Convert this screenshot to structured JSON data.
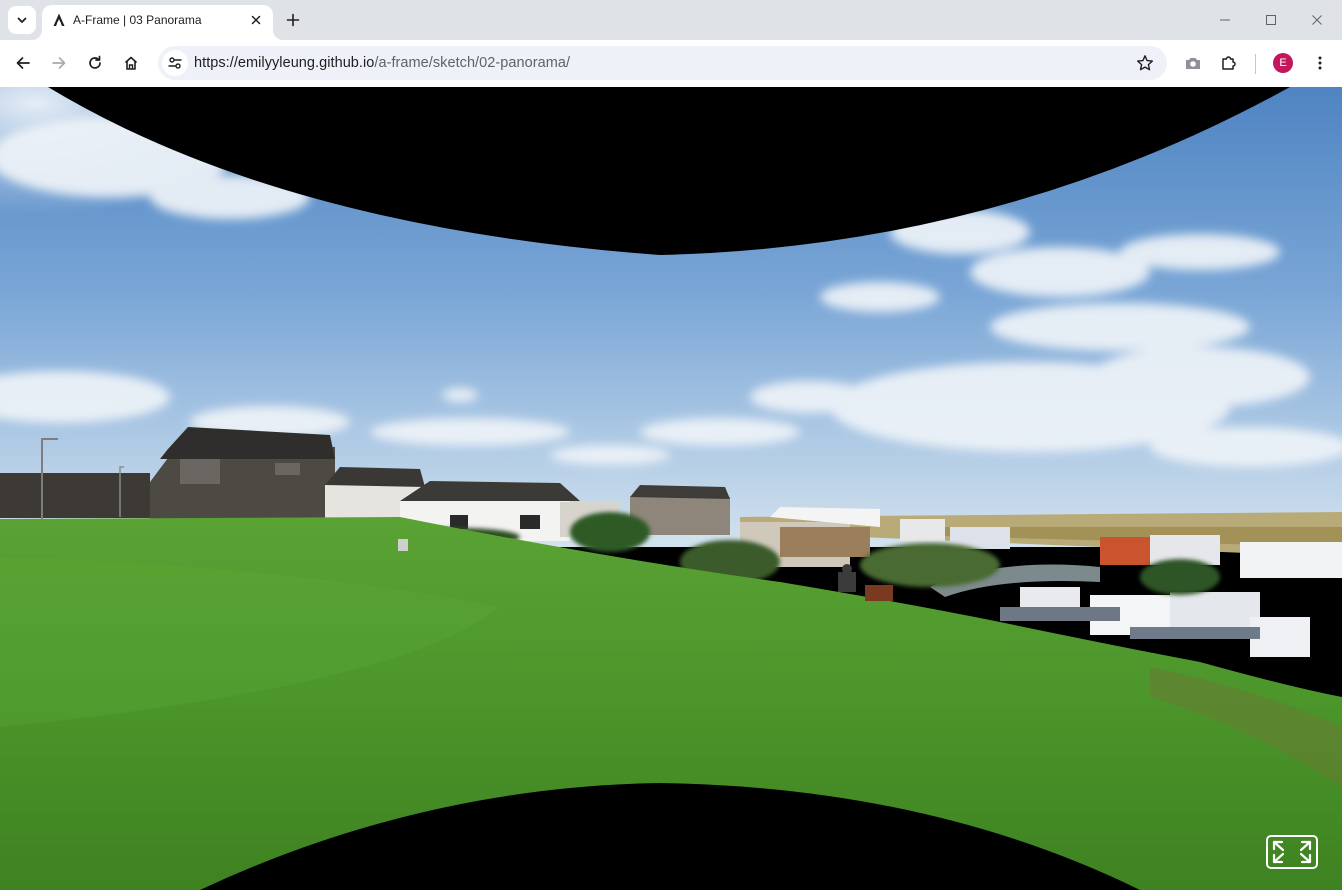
{
  "browser": {
    "tab": {
      "title": "A-Frame | 03 Panorama",
      "favicon_icon": "aframe-logo-icon",
      "close_icon": "close-icon"
    },
    "new_tab_icon": "plus-icon",
    "tab_search_icon": "chevron-down-icon",
    "window_controls": [
      "minimize-icon",
      "maximize-icon",
      "close-icon"
    ],
    "toolbar": {
      "back_icon": "back-arrow-icon",
      "forward_icon": "forward-arrow-icon",
      "reload_icon": "reload-icon",
      "home_icon": "home-icon",
      "site_info_icon": "tune-icon",
      "url_scheme_host": "https://emilyyleung.github.io",
      "url_path": "/a-frame/sketch/02-panorama/",
      "bookmark_icon": "star-icon",
      "screenshot_icon": "camera-icon",
      "extensions_icon": "puzzle-icon",
      "profile_initial": "E",
      "menu_icon": "kebab-menu-icon"
    }
  },
  "scene": {
    "description_icon": "panorama-360",
    "sky_color_top": "#5d8fc8",
    "sky_color_horizon": "#b9d3ea",
    "grass_color": "#4f9a2c",
    "fullscreen_icon": "enter-vr-fullscreen-icon"
  },
  "colors": {
    "tabstrip_bg": "#dfe3e8",
    "omnibox_bg": "#eef1f7",
    "profile_bg": "#c2185b"
  }
}
